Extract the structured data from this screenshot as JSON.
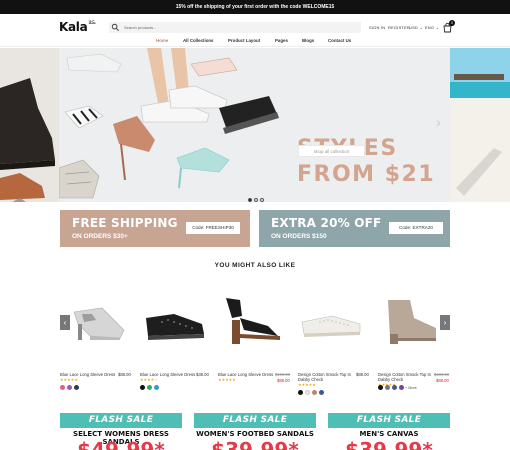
{
  "announcement": "15% off the shipping of your first order with the code WELCOME15",
  "header": {
    "logo": "Kala",
    "logo_mark": "ڪلا",
    "search_placeholder": "Search products...",
    "sign_in": "SIGN IN",
    "register": "REGISTER",
    "currency": "USD ⌄",
    "language": "ENG ⌄",
    "cart_count": "0"
  },
  "nav": [
    "Home",
    "All Collections",
    "Product Layout",
    "Pages",
    "Blogs",
    "Contact Us"
  ],
  "hero": {
    "title_line1": "STYLES",
    "title_line2": "FROM $21",
    "button": "shop all collection",
    "active_slide": 1,
    "slide_count": 3
  },
  "promos": [
    {
      "title": "FREE SHIPPING",
      "subtitle": "ON ORDERS $30+",
      "code": "Code: FREESHIP30",
      "color": "#c8a493"
    },
    {
      "title": "EXTRA 20% OFF",
      "subtitle": "ON ORDERS $150",
      "code": "Code: EXTRA20",
      "color": "#8ea6a9"
    }
  ],
  "section_title": "YOU MIGHT ALSO LIKE",
  "products": [
    {
      "name": "Blue Lace Long Sleeve Dress",
      "price": "$88.00",
      "stars": "★★★★★",
      "swatches": [
        "#e85a8b",
        "#9b59b6",
        "#2c3e50"
      ]
    },
    {
      "name": "Blue Lace Long Sleeve Dress",
      "price": "$38.00",
      "stars": "★★★★☆",
      "swatches": [
        "#111111",
        "#27ae60",
        "#3498db"
      ]
    },
    {
      "name": "Blue Lace Long Sleeve Dress",
      "old_price": "$100.00",
      "price": "$88.00",
      "stars": "★★★★★"
    },
    {
      "name": "Design Cotton Smock Top In",
      "name2": "Dabby Check",
      "price": "$88.00",
      "stars": "★★★★★",
      "swatches": [
        "#111111",
        "#e8e8e8",
        "#c0846c",
        "#3a5a9a"
      ]
    },
    {
      "name": "Design Cotton Smock Top In",
      "name2": "Dabby Check",
      "old_price": "$100.00",
      "price": "$88.00",
      "stars": "★★★★★",
      "swatches": [
        "#111111",
        "#777777",
        "#3a5a9a",
        "#7b3fa0"
      ],
      "more": "+ More"
    }
  ],
  "flash": [
    {
      "head": "FLASH SALE",
      "sub": "SELECT WOMENS DRESS SANDALS",
      "price": "$49.99*"
    },
    {
      "head": "FLASH SALE",
      "sub": "WOMEN'S FOOTBED SANDALS",
      "price": "$39.99*"
    },
    {
      "head": "FLASH SALE",
      "sub": "MEN'S CANVAS",
      "price": "$39.99*"
    }
  ],
  "colors": {
    "accent": "#c0846c",
    "promo_a": "#c8a493",
    "promo_b": "#8ea6a9",
    "flash": "#4fbfb6",
    "sale": "#e8394a"
  }
}
